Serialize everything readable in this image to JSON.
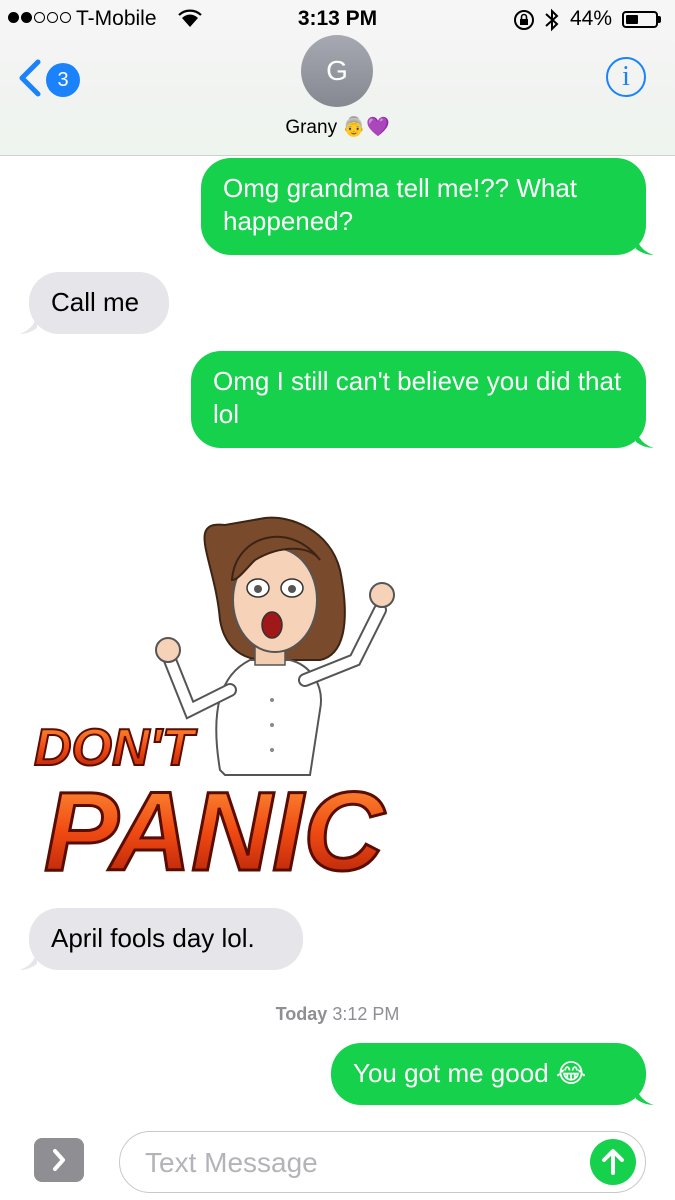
{
  "status_bar": {
    "carrier": "T-Mobile",
    "time": "3:13 PM",
    "battery_percent": "44%",
    "battery_level": 0.44,
    "signal_bars": 2
  },
  "header": {
    "back_count": "3",
    "avatar_initial": "G",
    "contact_name": "Grany 👵💜",
    "info_label": "i"
  },
  "messages": [
    {
      "from": "me",
      "text": "Omg grandma tell me!?? What happened?"
    },
    {
      "from": "them",
      "text": "Call me"
    },
    {
      "from": "me",
      "text": "Omg I still can't believe you did that lol"
    },
    {
      "from": "them",
      "type": "sticker",
      "text_1": "DON'T",
      "text_2": "PANIC"
    },
    {
      "from": "them",
      "text": "April fools day lol."
    },
    {
      "from": "me",
      "text": "You got me good 😂"
    }
  ],
  "timestamp": {
    "day": "Today",
    "time": "3:12 PM"
  },
  "compose": {
    "placeholder": "Text Message"
  },
  "colors": {
    "sent": "#15d14b",
    "received": "#e5e5ea",
    "accent": "#1a82fb"
  }
}
